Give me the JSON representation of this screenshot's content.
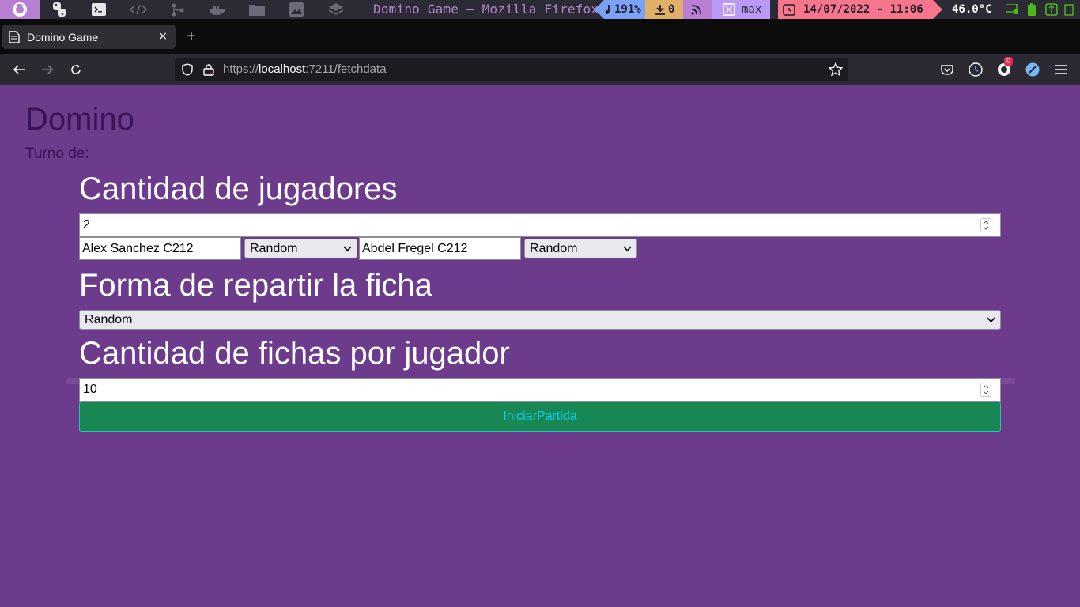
{
  "system_bar": {
    "window_title": "Domino Game — Mozilla Firefox",
    "volume": "191%",
    "downloads": "0",
    "layout": "max",
    "datetime": "14/07/2022 - 11:06",
    "temperature": "46.0°C"
  },
  "browser": {
    "tab_title": "Domino Game",
    "tab_close": "×",
    "new_tab": "+",
    "url_scheme": "https://",
    "url_host": "localhost",
    "url_rest": ":7211/fetchdata",
    "notification_count": "0"
  },
  "page": {
    "title": "Domino",
    "turn_label": "Turno de:",
    "players_heading": "Cantidad de jugadores",
    "players_count": "2",
    "players": [
      {
        "name": "Alex Sanchez C212",
        "strategy": "Random"
      },
      {
        "name": "Abdel Fregel C212",
        "strategy": "Random"
      }
    ],
    "deal_heading": "Forma de repartir la ficha",
    "deal_mode": "Random",
    "tiles_heading": "Cantidad de fichas por jugador",
    "tiles_count": "10",
    "start_button": "IniciarPartida"
  },
  "colors": {
    "page_background": "#6c3b8c",
    "title_color": "#3d1257",
    "button_background": "#198754",
    "button_text": "#0dcaf0"
  }
}
